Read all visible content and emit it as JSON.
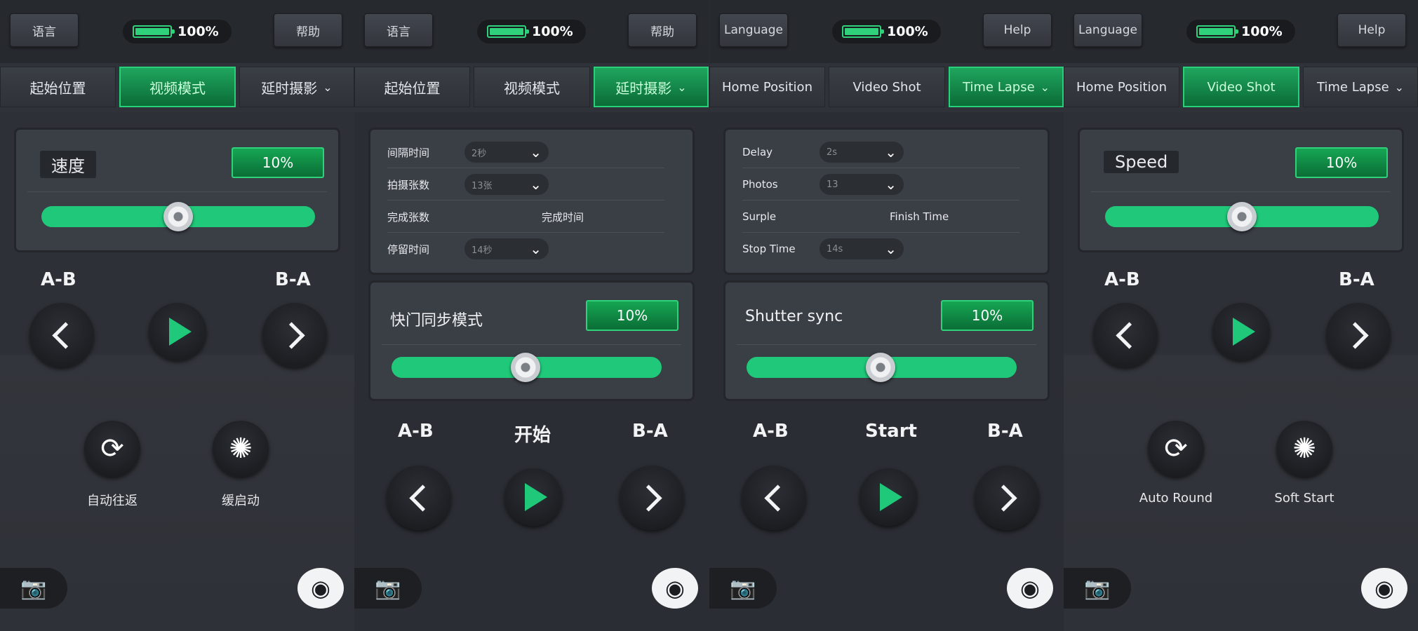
{
  "panels": [
    {
      "top": {
        "left": "语言",
        "battery": "100%",
        "right": "帮助"
      },
      "tabs": [
        "起始位置",
        "视频模式",
        "延时摄影"
      ],
      "speed": {
        "label": "速度",
        "value": "10%"
      },
      "ab": {
        "left": "A-B",
        "right": "B-A"
      },
      "features": {
        "auto": "自动往返",
        "soft": "缓启动"
      }
    },
    {
      "top": {
        "left": "语言",
        "battery": "100%",
        "right": "帮助"
      },
      "tabs": [
        "起始位置",
        "视频模式",
        "延时摄影"
      ],
      "settings": {
        "interval_label": "间隔时间",
        "interval_value": "2秒",
        "photos_label": "拍摄张数",
        "photos_value": "13张",
        "done_label": "完成张数",
        "finish_label": "完成时间",
        "stop_label": "停留时间",
        "stop_value": "14秒"
      },
      "sync": {
        "label": "快门同步模式",
        "value": "10%"
      },
      "ab": {
        "left": "A-B",
        "center": "开始",
        "right": "B-A"
      }
    },
    {
      "top": {
        "left": "Language",
        "battery": "100%",
        "right": "Help"
      },
      "tabs": [
        "Home Position",
        "Video Shot",
        "Time Lapse"
      ],
      "settings": {
        "interval_label": "Delay",
        "interval_value": "2s",
        "photos_label": "Photos",
        "photos_value": "13",
        "done_label": "Surple",
        "finish_label": "Finish Time",
        "stop_label": "Stop Time",
        "stop_value": "14s"
      },
      "sync": {
        "label": "Shutter sync",
        "value": "10%"
      },
      "ab": {
        "left": "A-B",
        "center": "Start",
        "right": "B-A"
      }
    },
    {
      "top": {
        "left": "Language",
        "battery": "100%",
        "right": "Help"
      },
      "tabs": [
        "Home Position",
        "Video Shot",
        "Time Lapse"
      ],
      "speed": {
        "label": "Speed",
        "value": "10%"
      },
      "ab": {
        "left": "A-B",
        "right": "B-A"
      },
      "features": {
        "auto": "Auto Round",
        "soft": "Soft Start"
      }
    }
  ],
  "colors": {
    "accent": "#20c97a",
    "panel": "#3a3e45",
    "bg": "#2d3036"
  },
  "icons": {
    "repeat": "repeat-icon",
    "soft": "sunburst-icon",
    "camera": "camera-icon",
    "shutter": "shutter-icon"
  }
}
